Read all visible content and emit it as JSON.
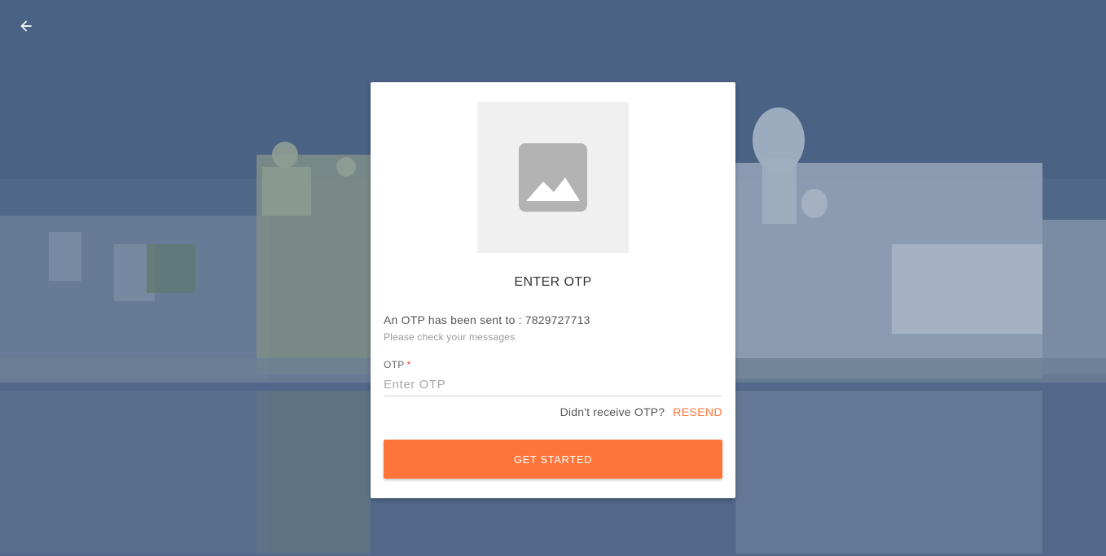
{
  "header": {
    "back_icon": "arrow-left-icon"
  },
  "card": {
    "logo_icon": "image-placeholder-icon",
    "title": "ENTER OTP",
    "otp_sent_prefix": "An OTP has been sent to :",
    "phone_number": "7829727713",
    "check_messages": "Please check your messages",
    "otp_field": {
      "label": "OTP",
      "required_mark": "*",
      "placeholder": "Enter OTP",
      "value": ""
    },
    "resend": {
      "question": "Didn't receive OTP?",
      "label": "RESEND"
    },
    "submit_label": "GET STARTED"
  },
  "colors": {
    "accent": "#ff7539",
    "required": "#e53935",
    "overlay": "#4a6284"
  }
}
